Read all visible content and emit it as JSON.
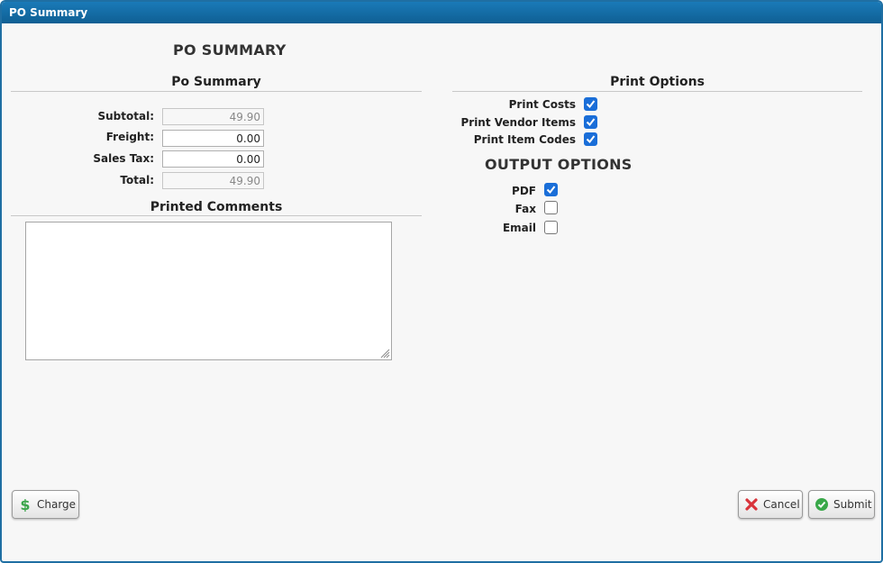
{
  "window": {
    "title": "PO Summary"
  },
  "header": {
    "title": "PO SUMMARY"
  },
  "summary": {
    "heading": "Po Summary",
    "fields": [
      {
        "label": "Subtotal:",
        "value": "49.90",
        "readonly": true
      },
      {
        "label": "Freight:",
        "value": "0.00",
        "readonly": false
      },
      {
        "label": "Sales Tax:",
        "value": "0.00",
        "readonly": false
      },
      {
        "label": "Total:",
        "value": "49.90",
        "readonly": true
      }
    ]
  },
  "comments": {
    "heading": "Printed Comments",
    "value": ""
  },
  "print_options": {
    "heading": "Print Options",
    "items": [
      {
        "label": "Print Costs",
        "checked": true
      },
      {
        "label": "Print Vendor Items",
        "checked": true
      },
      {
        "label": "Print Item Codes",
        "checked": true
      }
    ]
  },
  "output_options": {
    "heading": "OUTPUT OPTIONS",
    "items": [
      {
        "label": "PDF",
        "checked": true
      },
      {
        "label": "Fax",
        "checked": false
      },
      {
        "label": "Email",
        "checked": false
      }
    ]
  },
  "buttons": {
    "charge": "Charge",
    "cancel": "Cancel",
    "submit": "Submit"
  },
  "colors": {
    "titlebar": "#1a7ab8",
    "checkbox": "#1a6ed8",
    "charge_icon": "#3aa54a",
    "cancel_icon": "#d9333a",
    "submit_icon": "#39a849"
  }
}
